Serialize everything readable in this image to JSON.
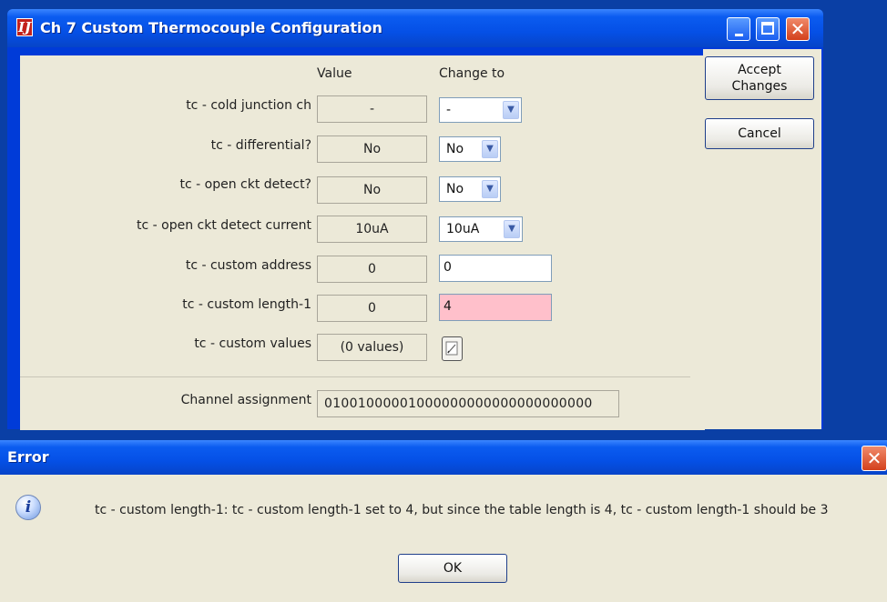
{
  "window": {
    "title": "Ch 7 Custom Thermocouple Configuration",
    "icon_glyph": "IJ",
    "controls": {
      "minimize_icon": "minimize-icon",
      "maximize_icon": "maximize-icon",
      "close_icon": "close-icon",
      "close_glyph": "✕"
    }
  },
  "table": {
    "value_header": "Value",
    "change_header": "Change to",
    "rows": [
      {
        "label": "tc - cold junction ch",
        "value": "-",
        "change": "-",
        "control": "dropdown"
      },
      {
        "label": "tc - differential?",
        "value": "No",
        "change": "No",
        "control": "dropdown"
      },
      {
        "label": "tc - open ckt detect?",
        "value": "No",
        "change": "No",
        "control": "dropdown"
      },
      {
        "label": "tc - open ckt detect current",
        "value": "10uA",
        "change": "10uA",
        "control": "dropdown"
      },
      {
        "label": "tc - custom address",
        "value": "0",
        "change": "0",
        "control": "text"
      },
      {
        "label": "tc - custom length-1",
        "value": "0",
        "change": "4",
        "control": "text",
        "error": true
      },
      {
        "label": "tc - custom values",
        "value": "(0 values)",
        "change": "",
        "control": "edit-button"
      }
    ],
    "channel_assignment": {
      "label": "Channel assignment",
      "value": "01001000001000000000000000000000"
    }
  },
  "buttons": {
    "accept_line1": "Accept",
    "accept_line2": "Changes",
    "cancel": "Cancel"
  },
  "error_dialog": {
    "title": "Error",
    "close_glyph": "✕",
    "icon_glyph": "i",
    "message": "tc - custom length-1: tc - custom length-1 set to 4, but since the table length is 4, tc - custom length-1 should be 3",
    "ok": "OK"
  },
  "colors": {
    "title_bar": "#0550e6",
    "panel_bg": "#ece9d8",
    "error_field_bg": "#ffc0cb",
    "close_button": "#d3401c"
  }
}
